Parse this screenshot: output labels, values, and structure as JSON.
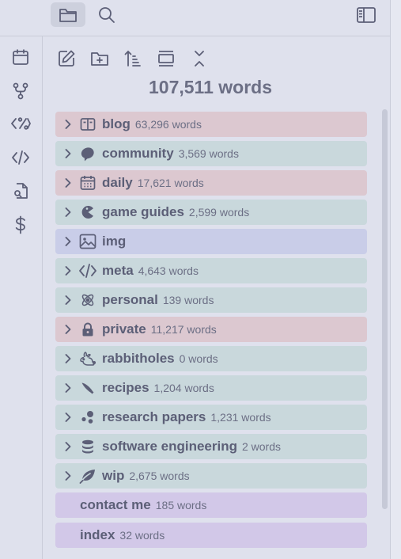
{
  "total_label": "107,511 words",
  "colors": {
    "red": "#dcc8d0",
    "teal": "#c9d8dc",
    "blue": "#c9cde8",
    "purple": "#d2c8e8"
  },
  "folders": [
    {
      "name": "blog",
      "count": "63,296 words",
      "icon": "book-open-icon",
      "color": "red"
    },
    {
      "name": "community",
      "count": "3,569 words",
      "icon": "chat-bubble-icon",
      "color": "teal"
    },
    {
      "name": "daily",
      "count": "17,621 words",
      "icon": "calendar-icon",
      "color": "red"
    },
    {
      "name": "game guides",
      "count": "2,599 words",
      "icon": "pacman-icon",
      "color": "teal"
    },
    {
      "name": "img",
      "count": "",
      "icon": "image-icon",
      "color": "blue"
    },
    {
      "name": "meta",
      "count": "4,643 words",
      "icon": "code-icon",
      "color": "teal"
    },
    {
      "name": "personal",
      "count": "139 words",
      "icon": "atom-icon",
      "color": "teal"
    },
    {
      "name": "private",
      "count": "11,217 words",
      "icon": "lock-icon",
      "color": "red"
    },
    {
      "name": "rabbitholes",
      "count": "0 words",
      "icon": "rabbit-icon",
      "color": "teal"
    },
    {
      "name": "recipes",
      "count": "1,204 words",
      "icon": "knife-icon",
      "color": "teal"
    },
    {
      "name": "research papers",
      "count": "1,231 words",
      "icon": "molecule-icon",
      "color": "teal"
    },
    {
      "name": "software engineering",
      "count": "2 words",
      "icon": "database-icon",
      "color": "teal"
    },
    {
      "name": "wip",
      "count": "2,675 words",
      "icon": "leaf-icon",
      "color": "teal"
    }
  ],
  "files": [
    {
      "name": "contact me",
      "count": "185 words",
      "color": "purple"
    },
    {
      "name": "index",
      "count": "32 words",
      "color": "purple"
    }
  ]
}
